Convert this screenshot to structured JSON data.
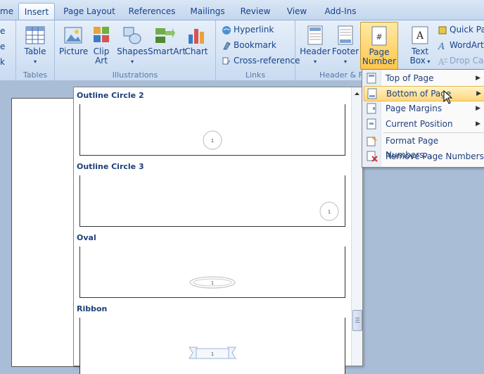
{
  "tabs": [
    "me",
    "Insert",
    "Page Layout",
    "References",
    "Mailings",
    "Review",
    "View",
    "Add-Ins"
  ],
  "groups": {
    "tables": {
      "label": "Tables",
      "table": "Table"
    },
    "illustrations": {
      "label": "Illustrations",
      "picture": "Picture",
      "clip_art_1": "Clip",
      "clip_art_2": "Art",
      "shapes": "Shapes",
      "smartart": "SmartArt",
      "chart": "Chart"
    },
    "links": {
      "label": "Links",
      "hyperlink": "Hyperlink",
      "bookmark": "Bookmark",
      "crossref": "Cross-reference"
    },
    "header_footer": {
      "label": "Header & F",
      "header": "Header",
      "footer": "Footer",
      "page_number_1": "Page",
      "page_number_2": "Number"
    },
    "text": {
      "textbox_1": "Text",
      "textbox_2": "Box",
      "quick_parts": "Quick Par",
      "wordart": "WordArt",
      "drop_cap": "Drop Cap"
    }
  },
  "left_cut": {
    "l1": "e",
    "l2": "e",
    "l3": "k"
  },
  "gallery": {
    "items": [
      {
        "title": "Outline Circle 2",
        "number": "1"
      },
      {
        "title": "Outline Circle 3",
        "number": "1"
      },
      {
        "title": "Oval",
        "number": "1"
      },
      {
        "title": "Ribbon",
        "number": "1"
      }
    ]
  },
  "menu": {
    "items": [
      "Top of Page",
      "Bottom of Page",
      "Page Margins",
      "Current Position",
      "Format Page Numbers...",
      "Remove Page Numbers"
    ]
  },
  "colors": {
    "accent": "#15428b",
    "highlight": "#ffd77c"
  }
}
